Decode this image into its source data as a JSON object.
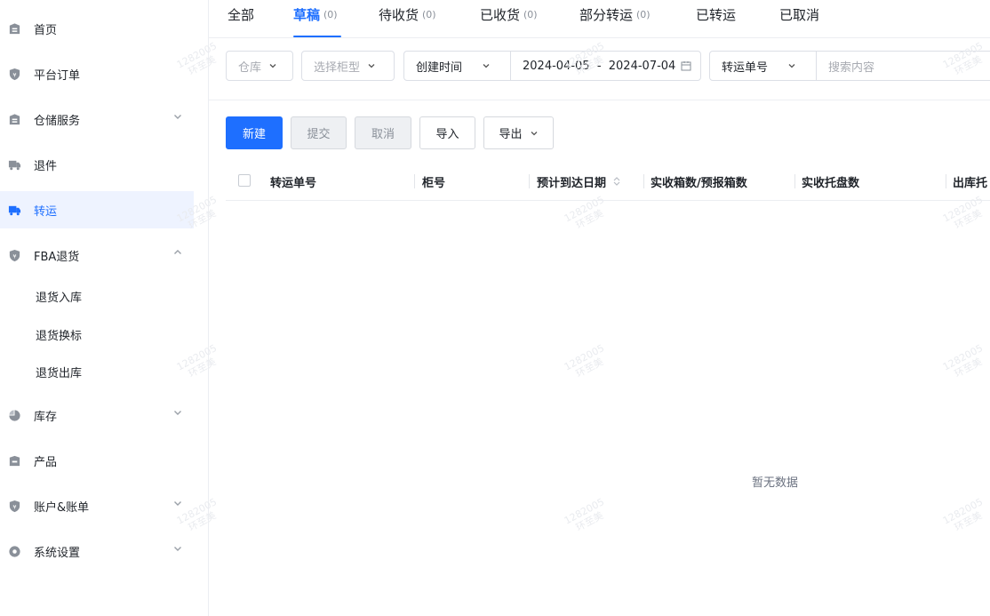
{
  "sidebar": {
    "items": [
      {
        "label": "首页",
        "icon": "home-icon"
      },
      {
        "label": "平台订单",
        "icon": "shield-icon"
      },
      {
        "label": "仓储服务",
        "icon": "home-icon"
      },
      {
        "label": "退件",
        "icon": "truck-icon"
      },
      {
        "label": "转运",
        "icon": "truck-icon"
      },
      {
        "label": "FBA退货",
        "icon": "shield-icon"
      },
      {
        "label": "库存",
        "icon": "pie-chart-icon"
      },
      {
        "label": "产品",
        "icon": "box-icon"
      },
      {
        "label": "账户&账单",
        "icon": "shield-icon"
      },
      {
        "label": "系统设置",
        "icon": "settings-icon"
      }
    ],
    "fba_sub_items": [
      "退货入库",
      "退货换标",
      "退货出库"
    ]
  },
  "tabs": [
    {
      "label": "全部",
      "count": ""
    },
    {
      "label": "草稿",
      "count": "(0)"
    },
    {
      "label": "待收货",
      "count": "(0)"
    },
    {
      "label": "已收货",
      "count": "(0)"
    },
    {
      "label": "部分转运",
      "count": "(0)"
    },
    {
      "label": "已转运",
      "count": ""
    },
    {
      "label": "已取消",
      "count": ""
    }
  ],
  "filters": {
    "warehouse_placeholder": "仓库",
    "cabinet_type_placeholder": "选择柜型",
    "date_type_value": "创建时间",
    "date_range": "2024-04-05  -  2024-07-04",
    "search_type_value": "转运单号",
    "search_placeholder": "搜索内容"
  },
  "actions": {
    "new": "新建",
    "submit": "提交",
    "cancel": "取消",
    "import": "导入",
    "export": "导出"
  },
  "table": {
    "columns": [
      "转运单号",
      "柜号",
      "预计到达日期",
      "实收箱数/预报箱数",
      "实收托盘数",
      "出库托"
    ],
    "empty_text": "暂无数据"
  },
  "watermark": {
    "line1": "1282005",
    "line2": "环至美"
  },
  "colors": {
    "accent": "#1e6fff",
    "active_bg": "#eef3ff"
  }
}
